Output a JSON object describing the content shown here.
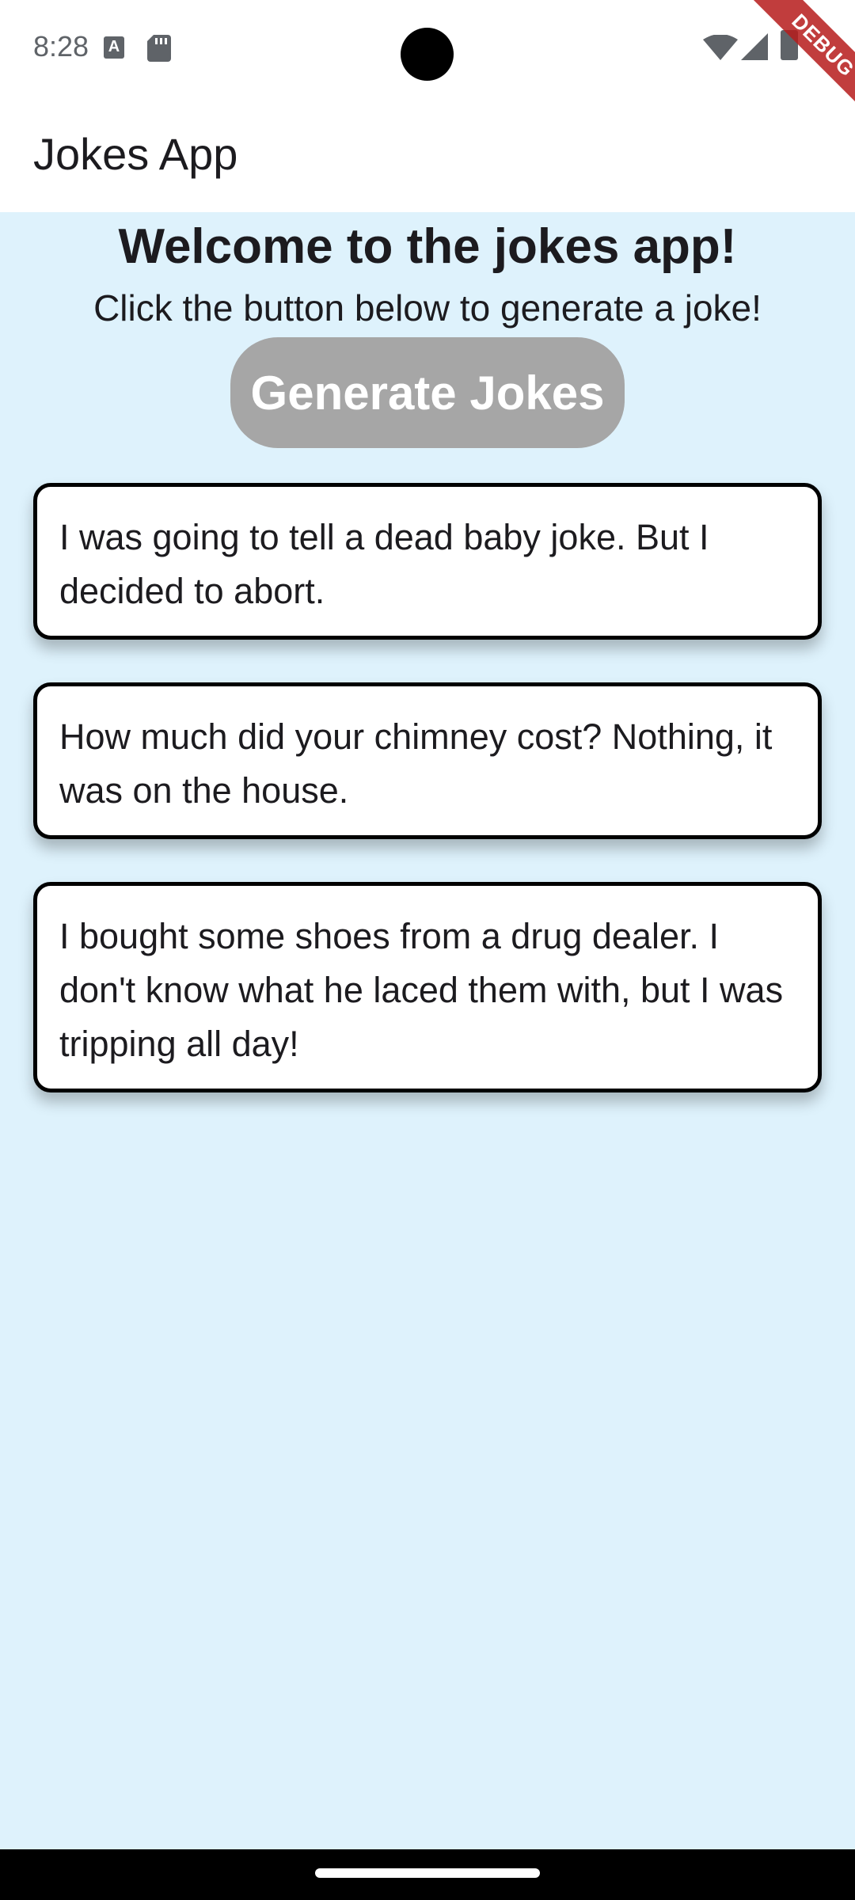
{
  "status_bar": {
    "time": "8:28",
    "icons": [
      "a-notification-icon",
      "sd-card-icon",
      "wifi-icon",
      "signal-icon",
      "battery-icon"
    ]
  },
  "debug_banner": {
    "label": "DEBUG",
    "color": "#b71c1c"
  },
  "app_bar": {
    "title": "Jokes App"
  },
  "main": {
    "heading": "Welcome to the jokes app!",
    "subheading": "Click the button below to generate a joke!",
    "generate_button_label": "Generate Jokes",
    "background_color": "#def2fc",
    "button_color": "#a6a6a6"
  },
  "jokes": [
    {
      "text": "I was going to tell a dead baby joke. But I decided to abort."
    },
    {
      "text": "How much did your chimney cost? Nothing, it was on the house."
    },
    {
      "text": "I bought some shoes from a drug dealer. I don't know what he laced them with, but I was tripping all day!"
    }
  ]
}
